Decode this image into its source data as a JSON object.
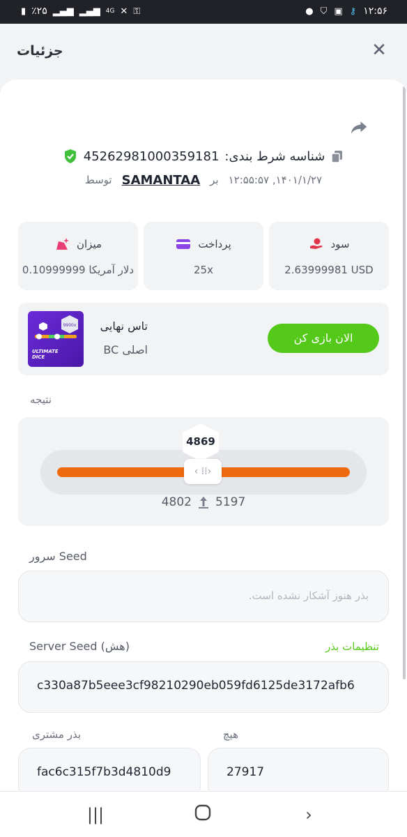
{
  "status_bar": {
    "time": "۱۲:۵۶",
    "battery": "٪۲۵",
    "network": "4G"
  },
  "header": {
    "title": "جزئیات"
  },
  "bet": {
    "id_label": "شناسه شرط بندی:",
    "id_value": "45262981000359181",
    "date": "۱۴۰۱/۱/۲۷, ۱۲:۵۵:۵۷",
    "on_label": "بر",
    "username": "SAMANTAA",
    "by_label": "توسط"
  },
  "stats": {
    "profit": {
      "label": "سود",
      "value": "2.63999981 USD"
    },
    "payout": {
      "label": "پرداخت",
      "value": "25x"
    },
    "amount": {
      "label": "میزان",
      "value": "دلار آمریکا 0.10999999"
    }
  },
  "game": {
    "name": "تاس نهایی",
    "sub": "اصلی BC",
    "play_label": "الان بازی کن",
    "thumb_text": "ULTIMATE\nDICE",
    "thumb_badge": "9900x"
  },
  "result": {
    "label": "نتیجه",
    "value": "4869",
    "range_low": "4802",
    "range_high": "5197",
    "fill_fraction": 1.0
  },
  "server_seed": {
    "label_rtl": "سرور",
    "label_ltr": "Seed",
    "placeholder": "بذر هنوز آشکار نشده است."
  },
  "server_seed_hash": {
    "label": "Server Seed",
    "label_suffix": "(هش)",
    "settings_label": "تنظیمات بذر",
    "value": "c330a87b5eee3cf98210290eb059fd6125de3172afb6"
  },
  "client_seed": {
    "label": "بذر مشتری",
    "value": "fac6c315f7b3d4810d9"
  },
  "nonce": {
    "label": "هیچ",
    "value": "27917"
  },
  "colors": {
    "accent_green": "#55c91a",
    "slider_orange": "#ef6a0f",
    "profit_red": "#e0364d",
    "payout_purple": "#8b45e6",
    "amount_pink": "#e83e74"
  }
}
